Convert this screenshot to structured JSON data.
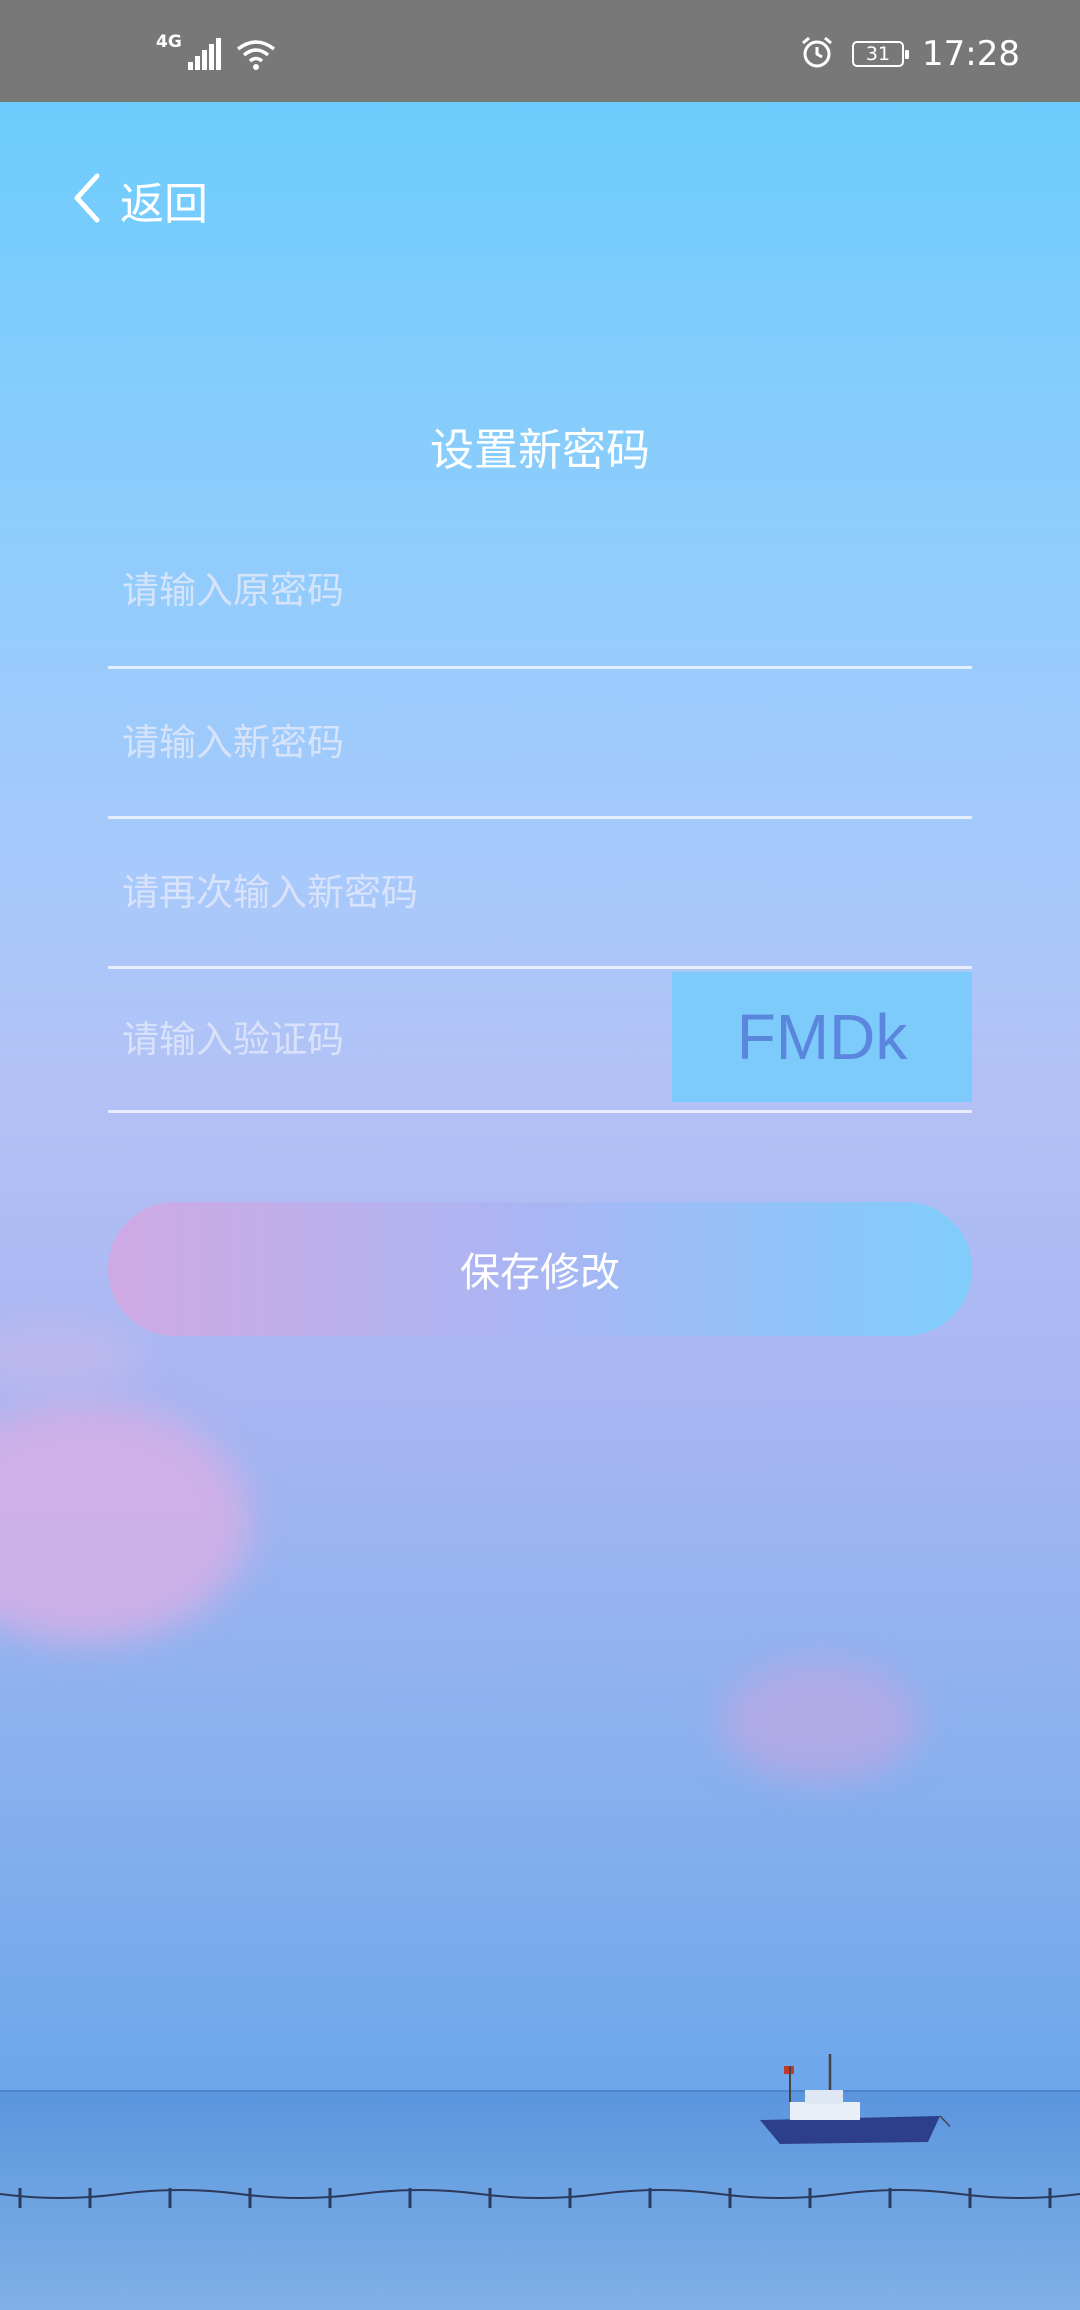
{
  "status_bar": {
    "network_label": "4G",
    "battery_level": "31",
    "time": "17:28",
    "icons": [
      "signal-icon",
      "wifi-icon",
      "alarm-icon",
      "battery-icon"
    ]
  },
  "nav": {
    "back_label": "返回",
    "back_icon": "chevron-left-icon"
  },
  "page": {
    "title": "设置新密码"
  },
  "form": {
    "old_password_placeholder": "请输入原密码",
    "new_password_placeholder": "请输入新密码",
    "confirm_password_placeholder": "请再次输入新密码",
    "captcha_placeholder": "请输入验证码",
    "captcha_code": "FMDk",
    "save_label": "保存修改"
  },
  "colors": {
    "status_bar": "#787878",
    "background_top": "#6dccfd",
    "background_bottom": "#5f9fe8",
    "captcha_background": "#7ccbfb",
    "captcha_text": "#5b86de",
    "button_gradient_start": "#cfa9e3",
    "button_gradient_end": "#7fcdfb"
  }
}
